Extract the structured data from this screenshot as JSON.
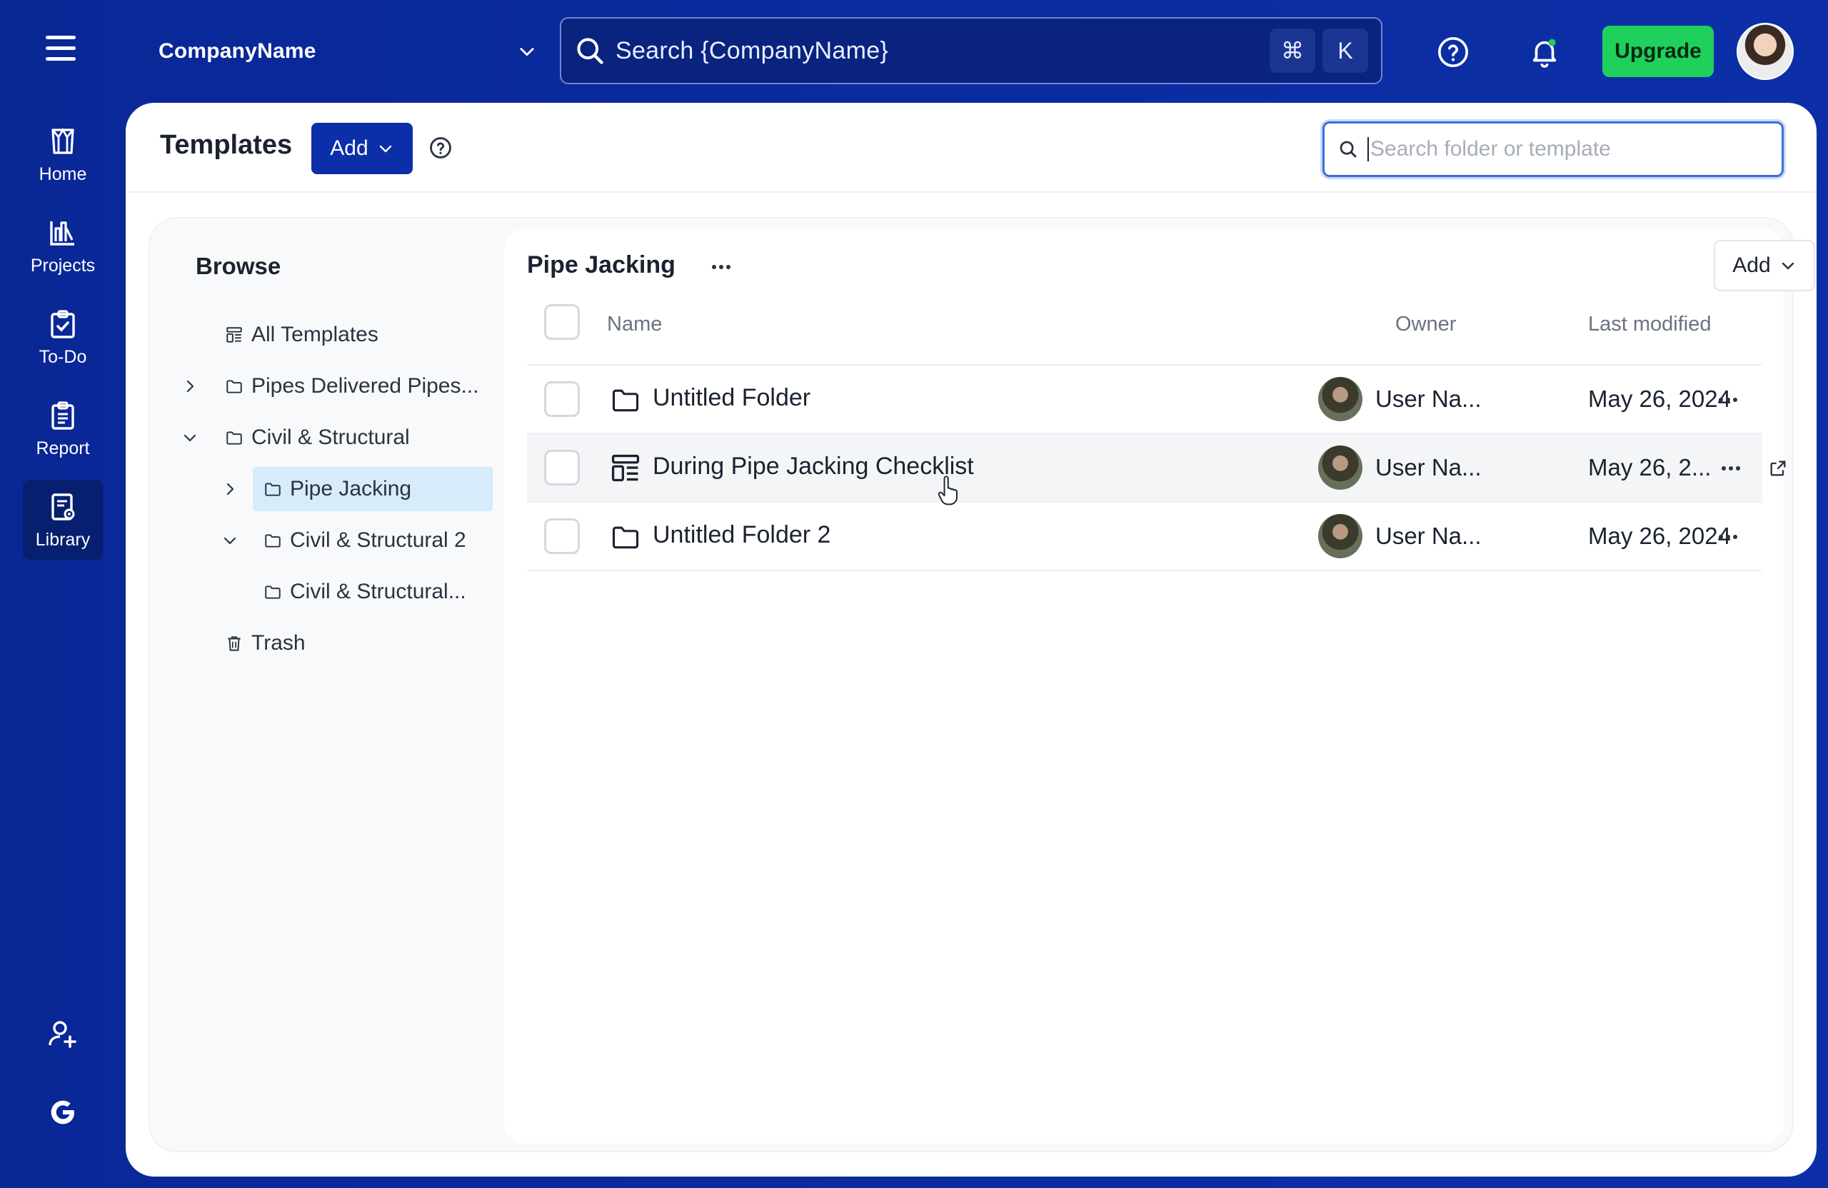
{
  "topbar": {
    "company_name": "CompanyName",
    "search_placeholder": "Search {CompanyName}",
    "shortcut_keys": [
      "⌘",
      "K"
    ],
    "upgrade_label": "Upgrade"
  },
  "nav": {
    "items": [
      {
        "label": "Home",
        "icon": "home-icon"
      },
      {
        "label": "Projects",
        "icon": "projects-icon"
      },
      {
        "label": "To-Do",
        "icon": "todo-icon"
      },
      {
        "label": "Report",
        "icon": "report-icon"
      },
      {
        "label": "Library",
        "icon": "library-icon",
        "active": true
      }
    ],
    "bottom": [
      "add-user-icon",
      "google-icon"
    ]
  },
  "header": {
    "title": "Templates",
    "add_label": "Add",
    "search_placeholder": "Search folder or template"
  },
  "browse": {
    "title": "Browse",
    "tree": [
      {
        "label": "All Templates",
        "icon": "templates-icon"
      },
      {
        "label": "Pipes Delivered Pipes...",
        "icon": "folder-icon",
        "expanded": false
      },
      {
        "label": "Civil & Structural",
        "icon": "folder-icon",
        "expanded": true
      },
      {
        "label": "Pipe Jacking",
        "icon": "folder-icon",
        "expanded": false,
        "selected": true
      },
      {
        "label": "Civil & Structural 2",
        "icon": "folder-icon",
        "expanded": true
      },
      {
        "label": "Civil & Structural...",
        "icon": "folder-icon"
      },
      {
        "label": "Trash",
        "icon": "trash-icon"
      }
    ]
  },
  "list": {
    "folder_title": "Pipe Jacking",
    "add_label": "Add",
    "columns": {
      "name": "Name",
      "owner": "Owner",
      "modified": "Last modified"
    },
    "rows": [
      {
        "type": "folder",
        "name": "Untitled Folder",
        "owner": "User Na...",
        "modified": "May 26, 2024"
      },
      {
        "type": "template",
        "name": "During Pipe Jacking Checklist",
        "owner": "User Na...",
        "modified": "May 26, 2..."
      },
      {
        "type": "folder",
        "name": "Untitled Folder 2",
        "owner": "User Na...",
        "modified": "May 26, 2024"
      }
    ]
  },
  "colors": {
    "brand_blue": "#0a2fa8",
    "upgrade_green": "#1fd05c",
    "selected_tree": "#d6ecfb"
  }
}
